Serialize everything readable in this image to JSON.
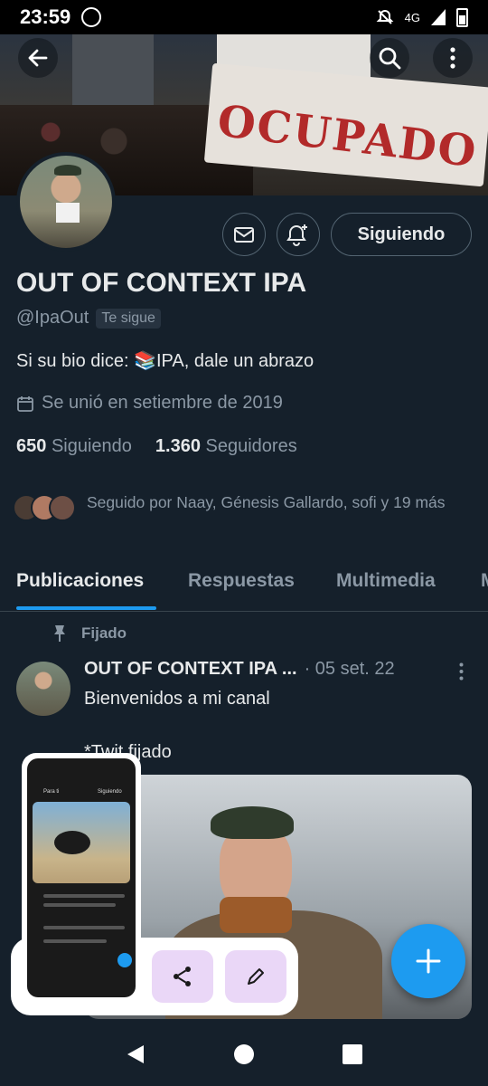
{
  "status_bar": {
    "time": "23:59",
    "network": "4G"
  },
  "profile": {
    "name": "OUT OF CONTEXT IPA",
    "handle": "@IpaOut",
    "follows_you": "Te sigue",
    "bio": "Si su bio dice: 📚IPA, dale un abrazo",
    "joined": "Se unió en setiembre de 2019",
    "following_count": "650",
    "following_label": "Siguiendo",
    "followers_count": "1.360",
    "followers_label": "Seguidores",
    "followed_by": "Seguido por Naay, Génesis Gallardo, sofi y 19 más",
    "follow_button": "Siguiendo",
    "banner_text": "OCUPADO"
  },
  "tabs": [
    "Publicaciones",
    "Respuestas",
    "Multimedia",
    "M"
  ],
  "post": {
    "pinned_label": "Fijado",
    "author": "OUT OF CONTEXT IPA ...",
    "date": "· 05 set. 22",
    "text1": "Bienvenidos a mi canal",
    "text2": "*Twit fijado"
  },
  "thumb": {
    "tab_left": "Para ti",
    "tab_right": "Siguiendo"
  },
  "icons": {
    "back": "arrow-left",
    "search": "magnifier",
    "more": "vertical-ellipsis",
    "message": "envelope",
    "notify": "bell-plus",
    "calendar": "calendar",
    "pin": "pushpin",
    "compose": "plus",
    "share": "share",
    "edit": "pencil"
  },
  "colors": {
    "background": "#15202b",
    "accent": "#1d9bf0",
    "muted": "#8b98a5",
    "share_action_bg": "#ead7f7"
  }
}
